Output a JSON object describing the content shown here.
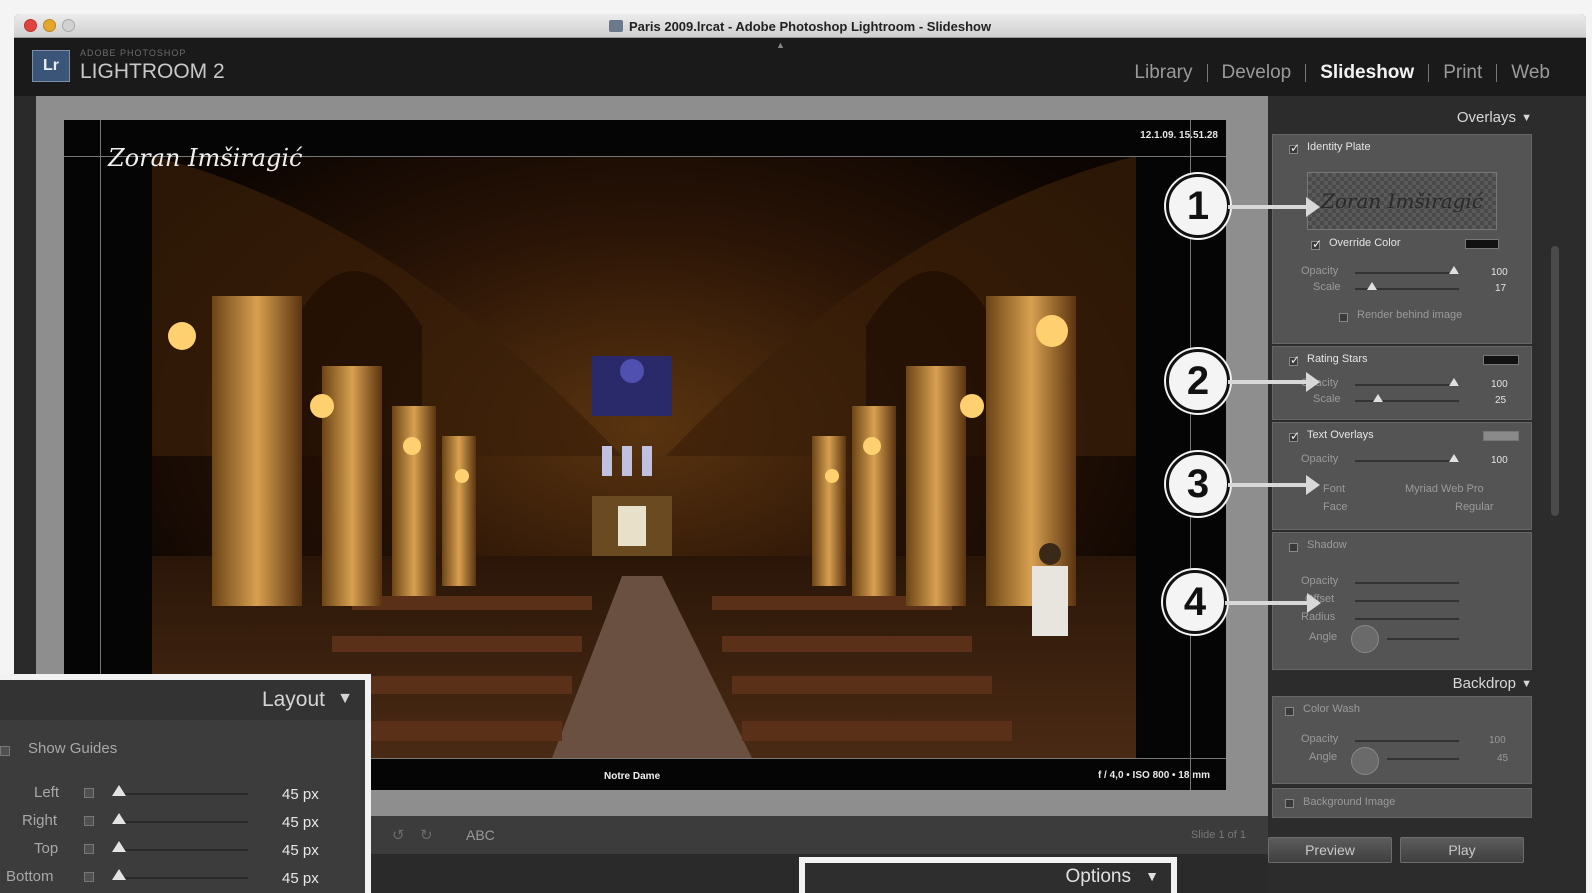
{
  "window": {
    "title": "Paris 2009.lrcat - Adobe Photoshop Lightroom - Slideshow"
  },
  "header": {
    "badge": "Lr",
    "brand_small": "ADOBE PHOTOSHOP",
    "brand": "LIGHTROOM 2",
    "modules": [
      "Library",
      "Develop",
      "Slideshow",
      "Print",
      "Web"
    ],
    "active_module": "Slideshow"
  },
  "slide": {
    "identity_plate": "Zoran Imširagić",
    "date": "12.1.09. 15.51.28",
    "caption": "Notre Dame",
    "exif": "f / 4,0 • ISO 800 • 18 mm"
  },
  "toolbar": {
    "abc_label": "ABC",
    "slide_counter": "Slide 1 of 1"
  },
  "overlays": {
    "header": "Overlays",
    "identity_plate": {
      "label": "Identity Plate",
      "checked": true,
      "preview_text": "Zoran Imširagić"
    },
    "override_color": {
      "label": "Override Color",
      "checked": true
    },
    "opacity_label": "Opacity",
    "scale_label": "Scale",
    "identity_opacity": "100",
    "identity_scale": "17",
    "render_behind": "Render behind image",
    "rating_stars": {
      "label": "Rating Stars",
      "checked": true
    },
    "rating_opacity": "100",
    "rating_scale": "25",
    "text_overlays": {
      "label": "Text Overlays",
      "checked": true
    },
    "text_opacity": "100",
    "font_label": "Font",
    "face_label": "Face",
    "font_value": "Myriad Web Pro",
    "face_value": "Regular",
    "shadow": {
      "label": "Shadow",
      "checked": false
    },
    "offset_label": "Offset",
    "radius_label": "Radius",
    "angle_label": "Angle"
  },
  "backdrop": {
    "header": "Backdrop",
    "color_wash": {
      "label": "Color Wash",
      "checked": false
    },
    "opacity_label": "Opacity",
    "angle_label": "Angle",
    "color_wash_opacity": "100",
    "color_wash_angle": "45",
    "background_image": {
      "label": "Background Image",
      "checked": false
    }
  },
  "buttons": {
    "preview": "Preview",
    "play": "Play"
  },
  "callouts": [
    "1",
    "2",
    "3",
    "4"
  ],
  "layout_panel": {
    "header": "Layout",
    "show_guides": "Show Guides",
    "rows": [
      {
        "label": "Left",
        "value": "45 px"
      },
      {
        "label": "Right",
        "value": "45 px"
      },
      {
        "label": "Top",
        "value": "45 px"
      },
      {
        "label": "Bottom",
        "value": "45 px"
      }
    ]
  },
  "options_panel": {
    "header": "Options"
  }
}
